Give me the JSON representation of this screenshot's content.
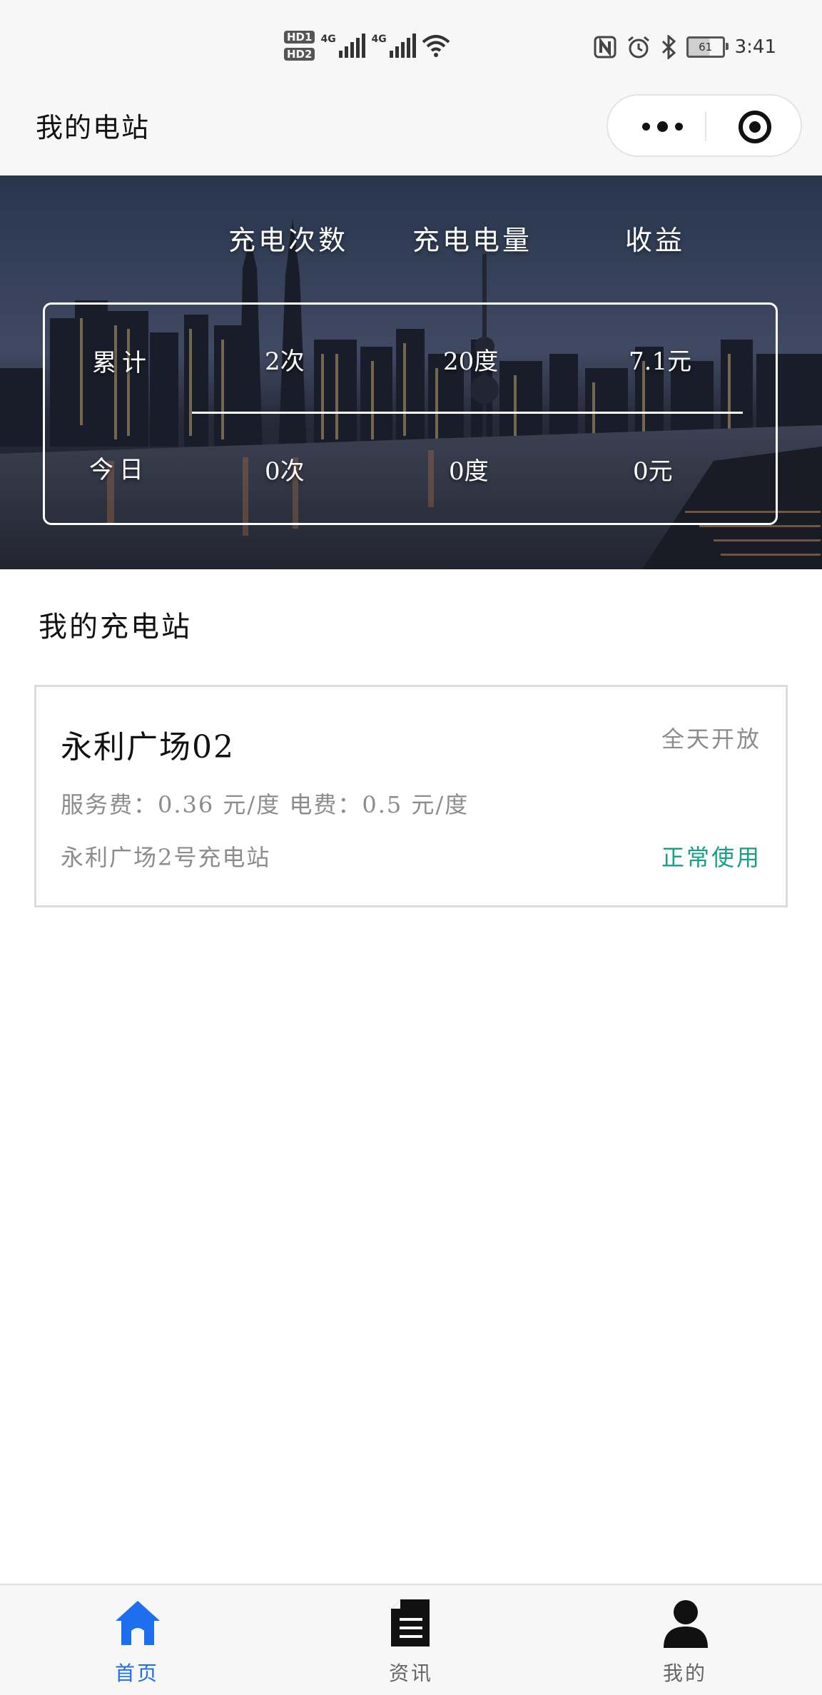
{
  "status_bar": {
    "hd_badges": [
      "HD1",
      "HD2"
    ],
    "network_labels": [
      "4G",
      "4G"
    ],
    "battery_level": "61",
    "time": "3:41",
    "icons": [
      "nfc-icon",
      "alarm-icon",
      "bluetooth-icon",
      "wifi-icon",
      "battery-icon"
    ]
  },
  "nav": {
    "title": "我的电站",
    "capsule_icons": [
      "more-dots-icon",
      "target-icon"
    ]
  },
  "summary": {
    "headers": [
      "充电次数",
      "充电电量",
      "收益"
    ],
    "rows": [
      {
        "label": "累计",
        "count": "2次",
        "energy": "20度",
        "income": "7.1元"
      },
      {
        "label": "今日",
        "count": "0次",
        "energy": "0度",
        "income": "0元"
      }
    ]
  },
  "section": {
    "title": "我的充电站"
  },
  "stations": [
    {
      "name": "永利广场02",
      "open_hours": "全天开放",
      "fees": "服务费：0.36 元/度 电费：0.5 元/度",
      "address": "永利广场2号充电站",
      "status": "正常使用",
      "status_color": "#159f86"
    }
  ],
  "tabs": [
    {
      "label": "首页",
      "icon": "home-icon",
      "active": true,
      "active_color": "#1e6ef0"
    },
    {
      "label": "资讯",
      "icon": "document-icon",
      "active": false
    },
    {
      "label": "我的",
      "icon": "user-icon",
      "active": false
    }
  ]
}
